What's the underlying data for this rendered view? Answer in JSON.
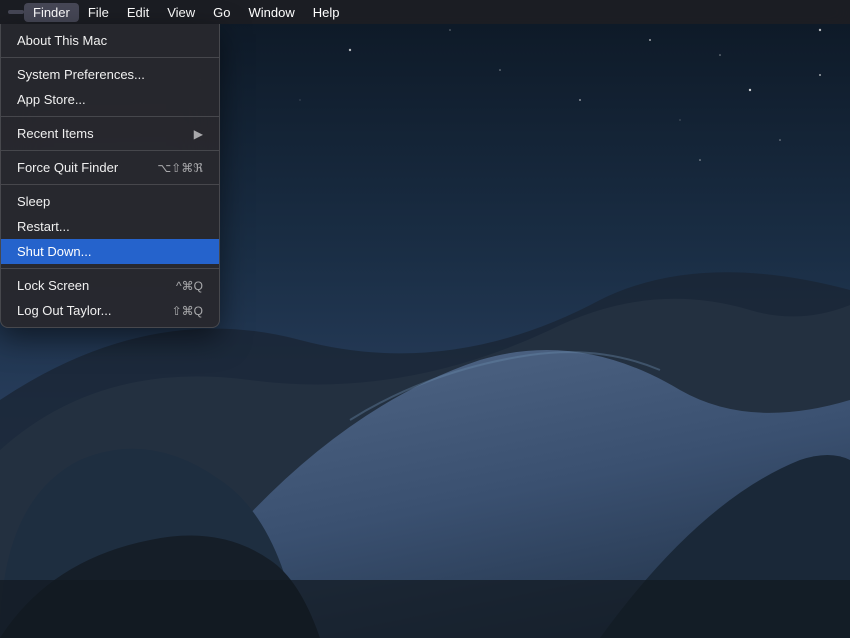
{
  "desktop": {
    "bg_description": "macOS Mojave dark desert dunes wallpaper"
  },
  "menubar": {
    "apple_symbol": "",
    "items": [
      {
        "label": "Finder",
        "active": true
      },
      {
        "label": "File"
      },
      {
        "label": "Edit"
      },
      {
        "label": "View"
      },
      {
        "label": "Go"
      },
      {
        "label": "Window"
      },
      {
        "label": "Help"
      }
    ]
  },
  "apple_menu": {
    "items": [
      {
        "id": "about",
        "label": "About This Mac",
        "shortcut": "",
        "type": "item"
      },
      {
        "id": "separator1",
        "type": "separator"
      },
      {
        "id": "system-prefs",
        "label": "System Preferences...",
        "shortcut": "",
        "type": "item"
      },
      {
        "id": "app-store",
        "label": "App Store...",
        "shortcut": "",
        "type": "item"
      },
      {
        "id": "separator2",
        "type": "separator"
      },
      {
        "id": "recent-items",
        "label": "Recent Items",
        "shortcut": "▶",
        "type": "item-arrow"
      },
      {
        "id": "separator3",
        "type": "separator"
      },
      {
        "id": "force-quit",
        "label": "Force Quit Finder",
        "shortcut": "⌥⇧⌘ℜ",
        "type": "item"
      },
      {
        "id": "separator4",
        "type": "separator"
      },
      {
        "id": "sleep",
        "label": "Sleep",
        "shortcut": "",
        "type": "item"
      },
      {
        "id": "restart",
        "label": "Restart...",
        "shortcut": "",
        "type": "item"
      },
      {
        "id": "shutdown",
        "label": "Shut Down...",
        "shortcut": "",
        "type": "item",
        "highlighted": true
      },
      {
        "id": "separator5",
        "type": "separator"
      },
      {
        "id": "lock-screen",
        "label": "Lock Screen",
        "shortcut": "^⌘Q",
        "type": "item"
      },
      {
        "id": "logout",
        "label": "Log Out Taylor...",
        "shortcut": "⇧⌘Q",
        "type": "item"
      }
    ]
  }
}
